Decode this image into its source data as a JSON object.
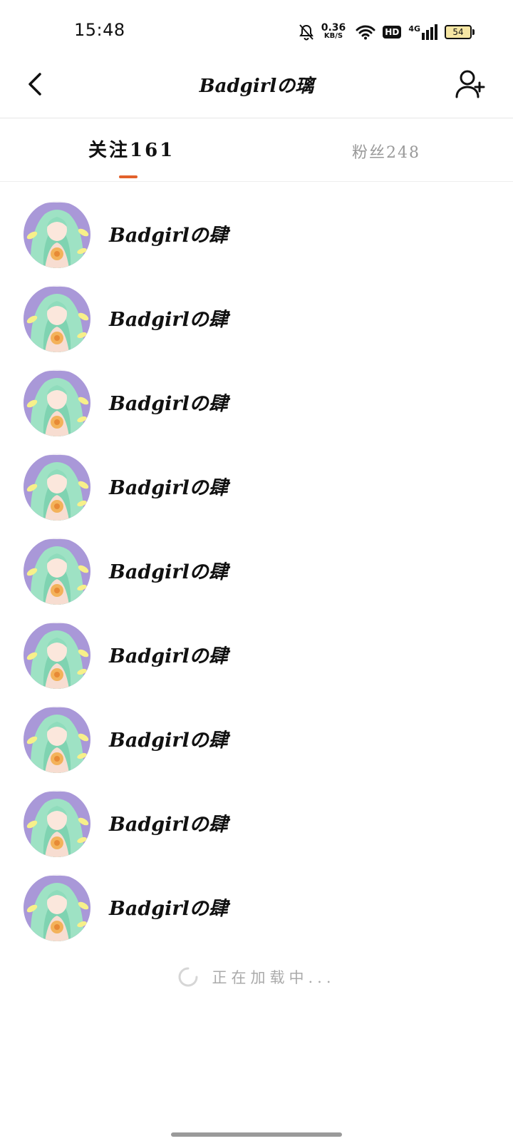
{
  "status_bar": {
    "time": "15:48",
    "net_speed_value": "0.36",
    "net_speed_unit": "KB/S",
    "hd_label": "HD",
    "network_label": "4G",
    "battery_level": "54"
  },
  "header": {
    "title": "Badgirlの璃"
  },
  "tabs": [
    {
      "label": "关注161",
      "active": true
    },
    {
      "label": "粉丝248",
      "active": false
    }
  ],
  "users": [
    {
      "name": "Badgirlの肆"
    },
    {
      "name": "Badgirlの肆"
    },
    {
      "name": "Badgirlの肆"
    },
    {
      "name": "Badgirlの肆"
    },
    {
      "name": "Badgirlの肆"
    },
    {
      "name": "Badgirlの肆"
    },
    {
      "name": "Badgirlの肆"
    },
    {
      "name": "Badgirlの肆"
    },
    {
      "name": "Badgirlの肆"
    }
  ],
  "loading_text": "正在加载中...",
  "colors": {
    "accent": "#e2612b",
    "inactive_text": "#999999",
    "divider": "#eeeeee"
  }
}
